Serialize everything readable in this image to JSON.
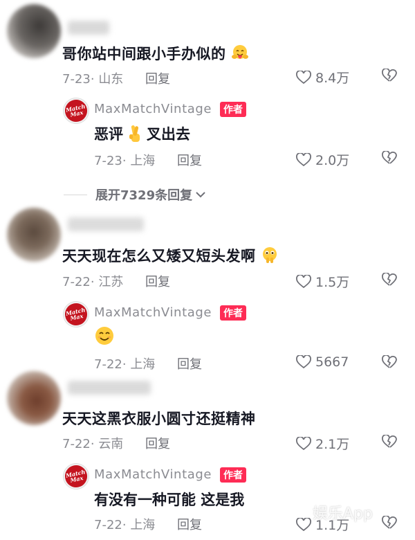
{
  "comments": [
    {
      "text": "哥你站中间跟小手办似的",
      "date": "7-23",
      "location": "山东",
      "reply_label": "回复",
      "likes": "8.4万",
      "emoji": "hug-face-icon",
      "author_reply": {
        "author": "MaxMatchVintage",
        "badge": "作者",
        "text": "恶评",
        "suffix": "叉出去",
        "emoji": "crossed-fingers-icon",
        "date": "7-23",
        "location": "上海",
        "reply_label": "回复",
        "likes": "2.0万"
      },
      "expand_label": "展开7329条回复"
    },
    {
      "text": "天天现在怎么又矮又短头发啊",
      "date": "7-22",
      "location": "江苏",
      "reply_label": "回复",
      "likes": "1.5万",
      "emoji": "pleading-hands-face-icon",
      "author_reply": {
        "author": "MaxMatchVintage",
        "badge": "作者",
        "text": "",
        "emoji": "smiling-face-icon",
        "date": "7-22",
        "location": "上海",
        "reply_label": "回复",
        "likes": "5667"
      }
    },
    {
      "text": "天天这黑衣服小圆寸还挺精神",
      "date": "7-22",
      "location": "云南",
      "reply_label": "回复",
      "likes": "2.1万",
      "author_reply": {
        "author": "MaxMatchVintage",
        "badge": "作者",
        "text": "有没有一种可能 这是我",
        "date": "7-22",
        "location": "上海",
        "reply_label": "回复",
        "likes": "1.1万"
      }
    }
  ],
  "logo": {
    "line1": "Match",
    "line2": "Max"
  },
  "watermark": "娱乐App",
  "colors": {
    "badge": "#fe2c55",
    "logo": "#c4141f",
    "meta": "#8a8b91"
  }
}
